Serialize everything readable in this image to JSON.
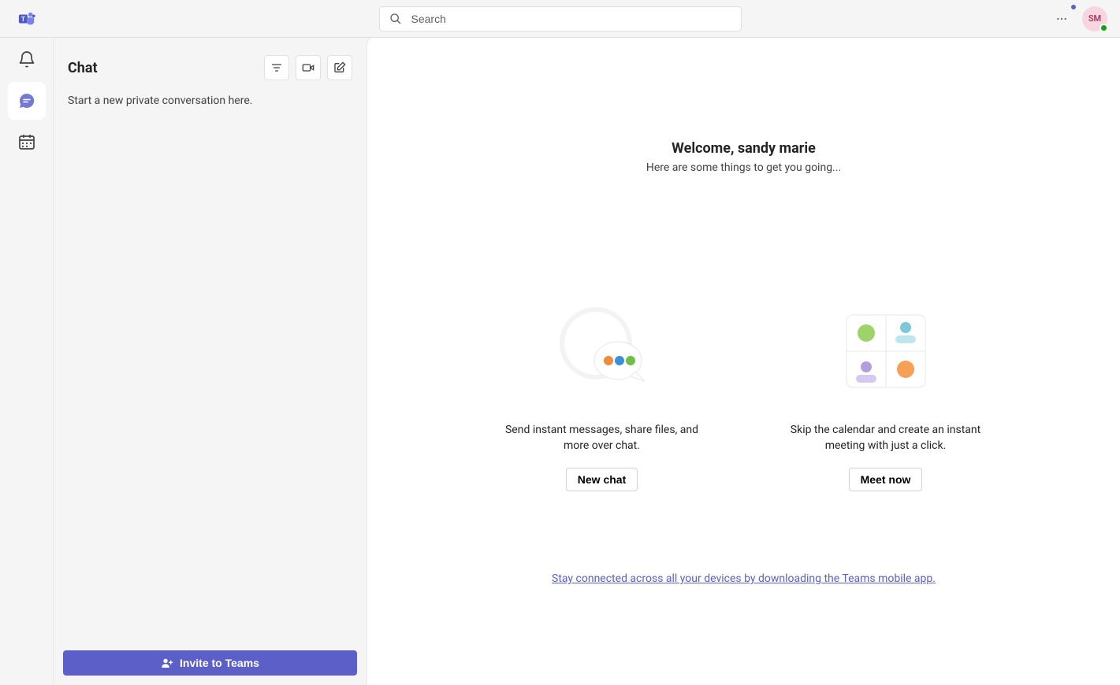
{
  "header": {
    "search_placeholder": "Search",
    "avatar_initials": "SM"
  },
  "sidebar": {
    "title": "Chat",
    "empty_hint": "Start a new private conversation here.",
    "invite_label": "Invite to Teams"
  },
  "welcome": {
    "title": "Welcome, sandy marie",
    "subtitle": "Here are some things to get you going...",
    "cards": [
      {
        "desc": "Send instant messages, share files, and more over chat.",
        "button": "New chat"
      },
      {
        "desc": "Skip the calendar and create an instant meeting with just a click.",
        "button": "Meet now"
      }
    ],
    "footer_link": "Stay connected across all your devices by downloading the Teams mobile app."
  },
  "colors": {
    "accent": "#5b5fc7"
  }
}
